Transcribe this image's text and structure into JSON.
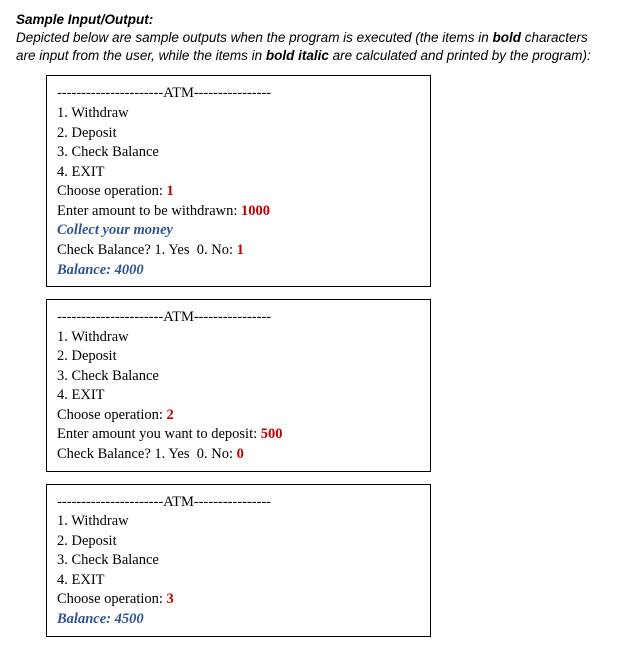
{
  "heading": "Sample Input/Output:",
  "intro": {
    "p1": "Depicted below are sample outputs when the program is executed (the items in ",
    "bold_word": "bold",
    "p2": " characters are input from the user, while the items in ",
    "bolditalic_word": "bold italic",
    "p3": " are calculated and printed by the program):"
  },
  "atm_header": "----------------------ATM----------------",
  "menu": {
    "m1": "1. Withdraw",
    "m2": "2. Deposit",
    "m3": "3. Check Balance",
    "m4": "4. EXIT"
  },
  "prompt_choose": "Choose operation: ",
  "box1": {
    "op": "1",
    "withdraw_prompt": "Enter amount to be withdrawn: ",
    "withdraw_amt": "1000",
    "collect": "Collect your money",
    "checkbal_prompt": "Check Balance? 1. Yes  0. No: ",
    "checkbal_ans": "1",
    "balance": "Balance: 4000"
  },
  "box2": {
    "op": "2",
    "deposit_prompt": "Enter amount you want to deposit: ",
    "deposit_amt": "500",
    "checkbal_prompt": "Check Balance? 1. Yes  0. No: ",
    "checkbal_ans": "0"
  },
  "box3": {
    "op": "3",
    "balance": "Balance: 4500"
  }
}
